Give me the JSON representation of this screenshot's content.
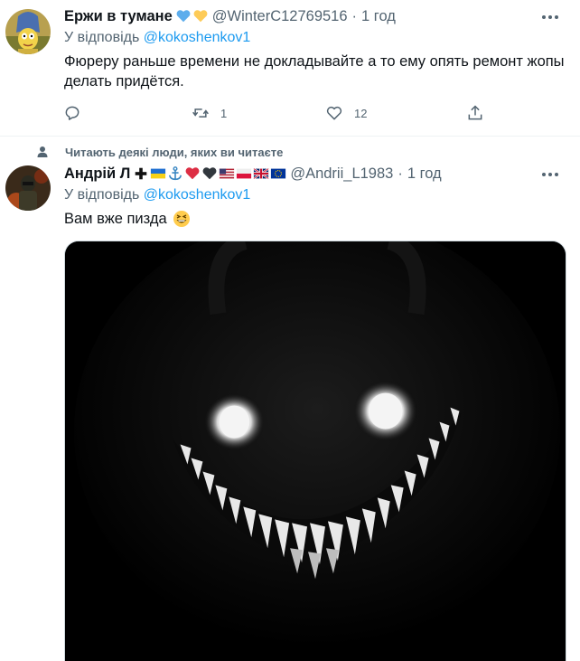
{
  "tweets": [
    {
      "display_name": "Ержи в тумане",
      "name_emojis": [
        "blue-heart-icon",
        "yellow-heart-icon"
      ],
      "handle": "@WinterC12769516",
      "separator": "·",
      "time": "1 год",
      "reply_prefix": "У відповідь",
      "reply_to": "@kokoshenkov1",
      "text": "Фюреру раньше времени не докладывайте а то ему опять ремонт жопы делать придётся.",
      "actions": {
        "reply_count": "",
        "retweet_count": "1",
        "like_count": "12"
      }
    },
    {
      "social_context": "Читають деякі люди, яких ви читаєте",
      "display_name": "Андрій Л",
      "name_emojis": [
        "cross-icon",
        "ukraine-flag-icon",
        "anchor-icon",
        "red-heart-icon",
        "black-heart-icon",
        "usa-flag-icon",
        "poland-flag-icon",
        "uk-flag-icon",
        "eu-flag-icon"
      ],
      "handle": "@Andrii_L1983",
      "separator": "·",
      "time": "1 год",
      "reply_prefix": "У відповідь",
      "reply_to": "@kokoshenkov1",
      "text": "Вам вже пизда",
      "text_emoji": "grinning-squinting-face-icon",
      "media_description": "dark-smiling-creature-image"
    }
  ],
  "colors": {
    "link": "#1d9bf0",
    "secondary_text": "#536471",
    "primary_text": "#0f1419",
    "divider": "#eff3f4"
  }
}
